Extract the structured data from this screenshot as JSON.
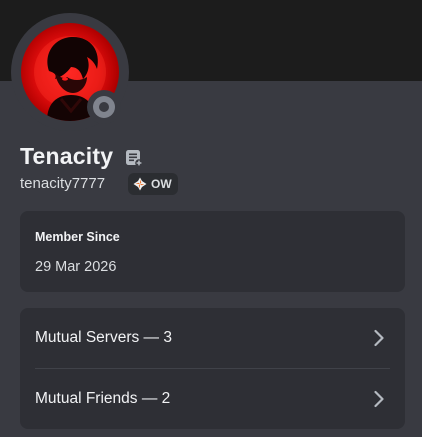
{
  "profile": {
    "display_name": "Tenacity",
    "username": "tenacity7777",
    "tag": "OW",
    "status": "offline",
    "banner_color": "#1c1c1c",
    "avatar_color": "#e00d0d"
  },
  "member_since": {
    "heading": "Member Since",
    "date": "29 Mar 2026"
  },
  "mutuals": [
    {
      "label": "Mutual Servers — 3",
      "icon": "chevron-right-icon"
    },
    {
      "label": "Mutual Friends — 2",
      "icon": "chevron-right-icon"
    }
  ],
  "icons": {
    "note": "note-icon",
    "tag": "guild-tag-icon",
    "status": "offline-status-icon"
  },
  "colors": {
    "background": "#393a41",
    "card": "#2e2f35",
    "status_offline": "#80848e",
    "text_primary": "#f2f3f5"
  }
}
